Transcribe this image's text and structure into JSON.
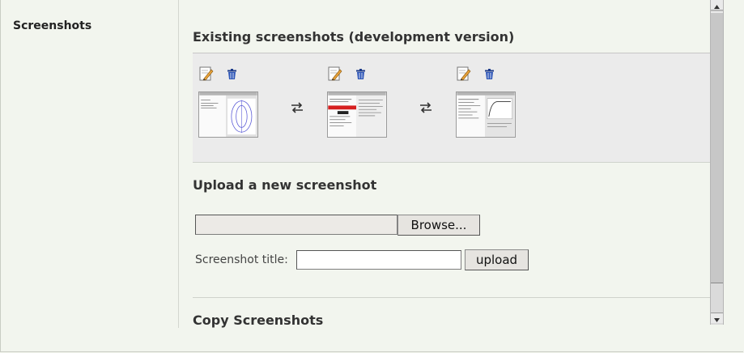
{
  "sidebar": {
    "title": "Screenshots"
  },
  "existing": {
    "heading": "Existing screenshots (development version)",
    "screenshots": [
      {
        "edit_icon": "edit-icon",
        "delete_icon": "trash-icon"
      },
      {
        "edit_icon": "edit-icon",
        "delete_icon": "trash-icon"
      },
      {
        "edit_icon": "edit-icon",
        "delete_icon": "trash-icon"
      }
    ],
    "swap_icon": "swap-arrows-icon"
  },
  "upload": {
    "heading": "Upload a new screenshot",
    "browse_label": "Browse...",
    "title_label": "Screenshot title:",
    "title_value": "",
    "upload_label": "upload"
  },
  "copy": {
    "heading": "Copy Screenshots"
  },
  "colors": {
    "background": "#f2f5ee",
    "gallery": "#ebebeb",
    "highlight_red": "#d62020"
  }
}
